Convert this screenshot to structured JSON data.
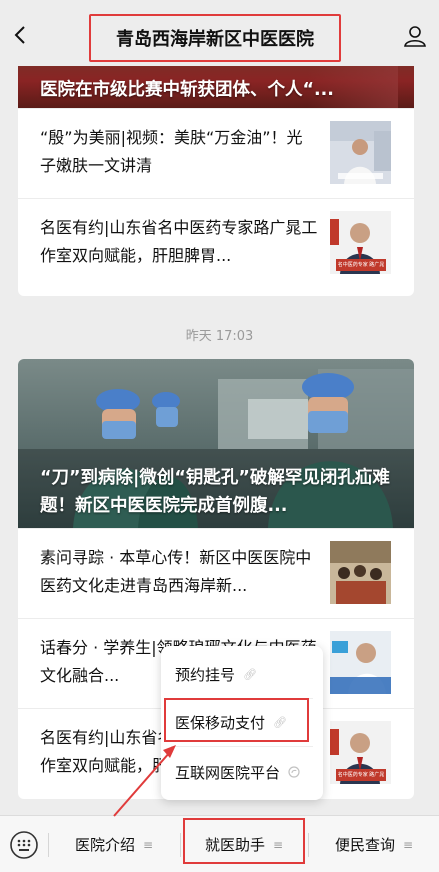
{
  "nav": {
    "title": "青岛西海岸新区中医医院",
    "back_icon": "chevron-left-icon",
    "profile_icon": "person-icon"
  },
  "feed": {
    "group1": {
      "hero_title": "医院在市级比赛中斩获团体、个人“...",
      "items": [
        {
          "title": "“殷”为美丽|视频：美肤“万金油”！光子嫩肤一文讲清"
        },
        {
          "title": "名医有约|山东省名中医药专家路广晁工作室双向赋能，肝胆脾胃...",
          "thumb_caption": "名中医药专家 路广晁"
        }
      ]
    },
    "timestamp": "昨天 17:03",
    "group2": {
      "hero_title": "“刀”到病除|微创“钥匙孔”破解罕见闭孔疝难题！新区中医医院完成首例腹...",
      "items": [
        {
          "title": "素问寻踪 · 本草心传！新区中医医院中医药文化走进青岛西海岸新..."
        },
        {
          "title": "话春分 · 学养生|领略琅琊文化与中医药文化融合..."
        },
        {
          "title": "名医有约|山东省名中医药专家路广晁工作室双向赋能，肝胆脾胃...",
          "thumb_caption": "名中医药专家 路广晁"
        }
      ]
    }
  },
  "popup_menu": {
    "items": [
      {
        "label": "预约挂号",
        "icon": "link-icon"
      },
      {
        "label": "医保移动支付",
        "icon": "link-icon"
      },
      {
        "label": "互联网医院平台",
        "icon": "mini-program-icon"
      }
    ],
    "highlighted_index": 1
  },
  "bottom_bar": {
    "keyboard_icon": "keyboard-icon",
    "tabs": [
      {
        "label": "医院介绍"
      },
      {
        "label": "就医助手"
      },
      {
        "label": "便民查询"
      }
    ],
    "highlighted_index": 1
  },
  "colors": {
    "highlight": "#e03b3b",
    "background": "#ededed",
    "card": "#ffffff"
  }
}
